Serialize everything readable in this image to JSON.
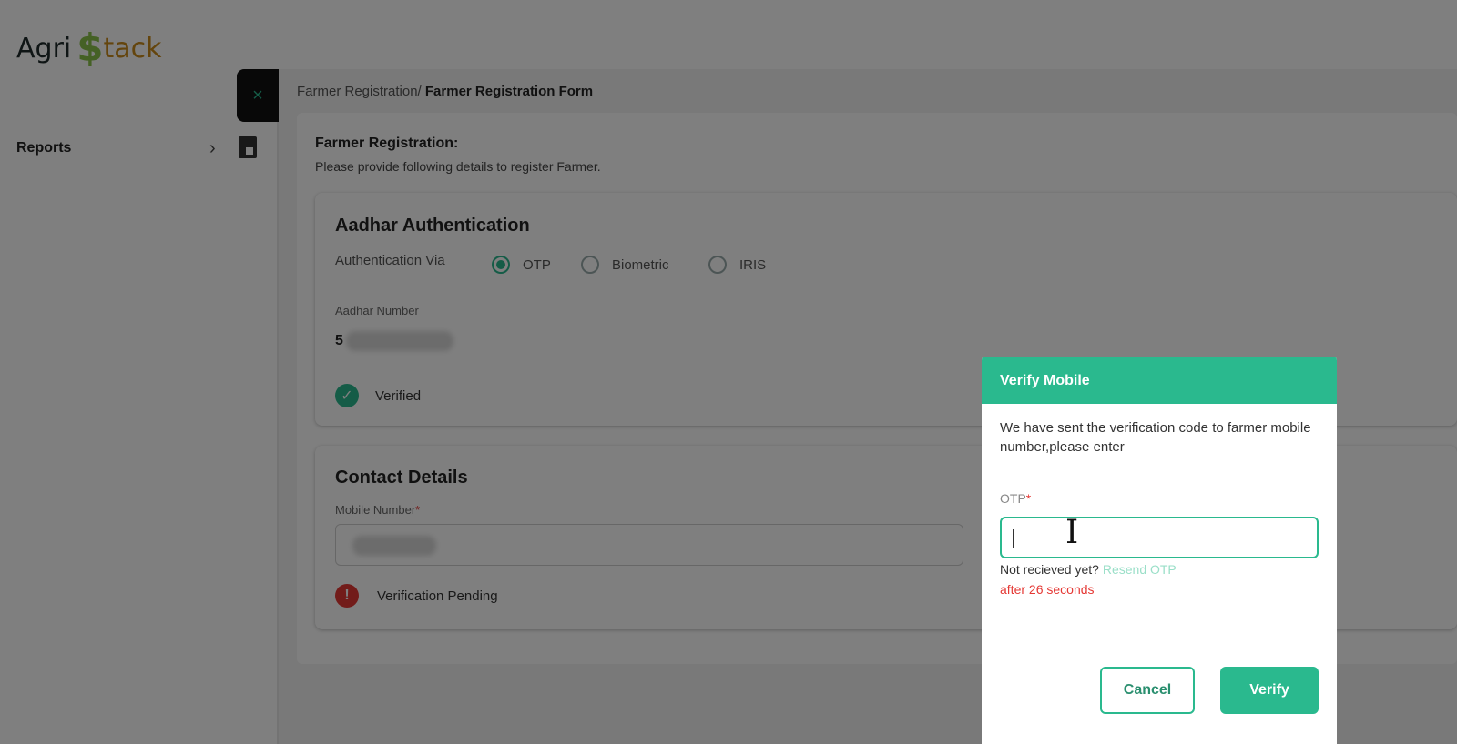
{
  "app": {
    "logo_part1": "Agri",
    "logo_part2": "$",
    "logo_part3": "tack"
  },
  "sidebar": {
    "close_glyph": "×",
    "items": [
      {
        "label": "Reports",
        "chevron": "›",
        "icon": "reports-icon"
      }
    ]
  },
  "breadcrumb": {
    "parent": "Farmer Registration/",
    "current": "Farmer Registration Form"
  },
  "form": {
    "title": "Farmer Registration:",
    "subtitle": "Please provide following details to register Farmer.",
    "aadhar": {
      "title": "Aadhar Authentication",
      "auth_via_label": "Authentication Via",
      "options": [
        "OTP",
        "Biometric",
        "IRIS"
      ],
      "selected": "OTP",
      "number_label": "Aadhar Number",
      "number_visible": "5",
      "status": "Verified"
    },
    "contact": {
      "title": "Contact Details",
      "mobile_label": "Mobile Number",
      "required_mark": "*",
      "status": "Verification Pending"
    }
  },
  "dialog": {
    "title": "Verify Mobile",
    "message": "We have sent the verification code to farmer mobile number,please enter",
    "otp_label": "OTP",
    "required_mark": "*",
    "otp_value": "",
    "not_received": "Not recieved yet?",
    "resend_label": "Resend OTP",
    "timer": "after 26 seconds",
    "cancel_label": "Cancel",
    "verify_label": "Verify"
  },
  "colors": {
    "accent": "#2ab98e",
    "error": "#e53935",
    "overlay": "rgba(0,0,0,0.5)"
  }
}
